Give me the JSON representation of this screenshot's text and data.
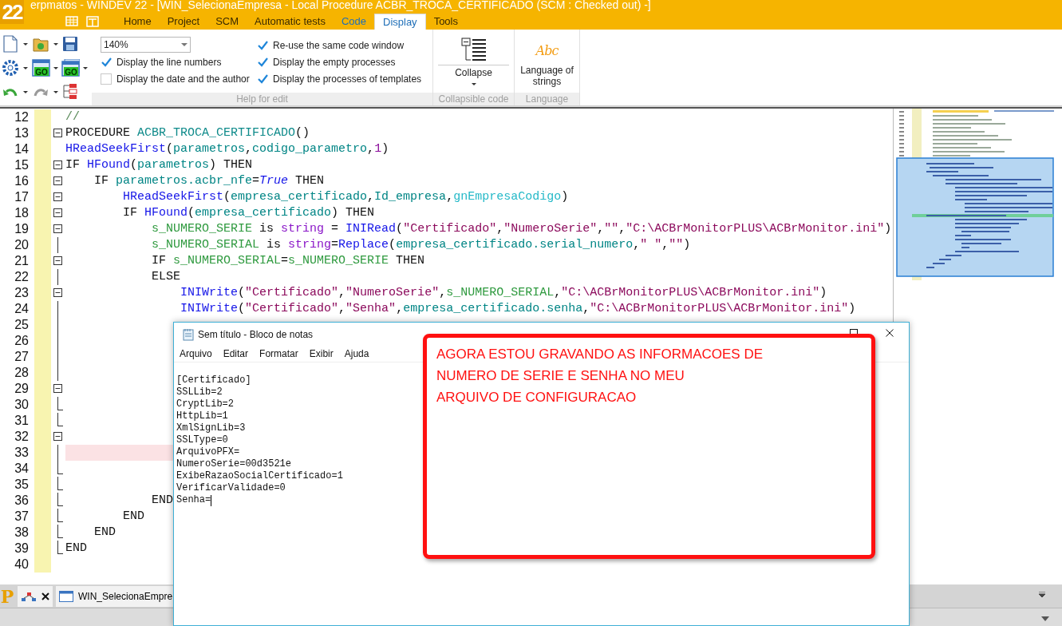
{
  "title_bar": {
    "logo": "22",
    "title": "erpmatos - WINDEV 22 - [WIN_SelecionaEmpresa - Local Procedure ACBR_TROCA_CERTIFICADO (SCM : Checked out) -]"
  },
  "title_tools": [
    {
      "kind": "grid"
    },
    {
      "kind": "form"
    }
  ],
  "ribbon_tabs": [
    {
      "label": "Home",
      "selected": false,
      "contextual": false
    },
    {
      "label": "Project",
      "selected": false,
      "contextual": false
    },
    {
      "label": "SCM",
      "selected": false,
      "contextual": false
    },
    {
      "label": "Automatic tests",
      "selected": false,
      "contextual": false
    },
    {
      "label": "Code",
      "selected": false,
      "contextual": true
    },
    {
      "label": "Display",
      "selected": true,
      "contextual": false
    },
    {
      "label": "Tools",
      "selected": false,
      "contextual": false
    }
  ],
  "quick_tools": [
    {
      "kind": "new",
      "menu": true
    },
    {
      "kind": "open",
      "menu": true
    },
    {
      "kind": "save",
      "menu": false
    },
    {
      "kind": "gear",
      "menu": true
    },
    {
      "kind": "go",
      "text": "GO",
      "menu": true
    },
    {
      "kind": "go2",
      "text": "GO",
      "menu": true
    },
    {
      "kind": "undo",
      "menu": true
    },
    {
      "kind": "redo",
      "menu": true
    },
    {
      "kind": "tree",
      "menu": false
    }
  ],
  "ribbon": {
    "zoom": "140%",
    "options_left": [
      {
        "label": "Display the line numbers",
        "checked": true
      },
      {
        "label": "Display the date and the author",
        "checked": false
      }
    ],
    "options_right": [
      {
        "label": "Re-use the same code window",
        "checked": true
      },
      {
        "label": "Display the empty processes",
        "checked": true
      },
      {
        "label": "Display the processes of templates",
        "checked": true
      }
    ],
    "help_group": "Help for edit",
    "collapse": {
      "label": "Collapse",
      "group": "Collapsible code"
    },
    "language": {
      "icon_text": "Abc",
      "label": "Language of strings",
      "group": "Language"
    }
  },
  "editor": {
    "lines": [
      {
        "number": "12",
        "kind": "plain",
        "highlighted": false,
        "tokens": [
          {
            "kind": "comment",
            "text": "//"
          }
        ]
      },
      {
        "number": "13",
        "kind": "fold",
        "highlighted": false,
        "tokens": [
          {
            "kind": "kw",
            "text": "PROCEDURE "
          },
          {
            "kind": "proc",
            "text": "ACBR_TROCA_CERTIFICADO"
          },
          {
            "kind": "punct",
            "text": "()"
          }
        ]
      },
      {
        "number": "14",
        "kind": "plain",
        "highlighted": false,
        "tokens": [
          {
            "kind": "func",
            "text": "HReadSeekFirst"
          },
          {
            "kind": "punct",
            "text": "("
          },
          {
            "kind": "var",
            "text": "parametros"
          },
          {
            "kind": "punct",
            "text": ","
          },
          {
            "kind": "var",
            "text": "codigo_parametro"
          },
          {
            "kind": "punct",
            "text": ","
          },
          {
            "kind": "num",
            "text": "1"
          },
          {
            "kind": "punct",
            "text": ")"
          }
        ]
      },
      {
        "number": "15",
        "kind": "fold",
        "highlighted": false,
        "tokens": [
          {
            "kind": "kw",
            "text": "IF "
          },
          {
            "kind": "func",
            "text": "HFound"
          },
          {
            "kind": "punct",
            "text": "("
          },
          {
            "kind": "var",
            "text": "parametros"
          },
          {
            "kind": "punct",
            "text": ") "
          },
          {
            "kind": "kw",
            "text": "THEN"
          }
        ]
      },
      {
        "number": "16",
        "kind": "fold",
        "highlighted": false,
        "tokens": [
          {
            "kind": "kw",
            "text": "    IF "
          },
          {
            "kind": "var",
            "text": "parametros.acbr_nfe"
          },
          {
            "kind": "punct",
            "text": "="
          },
          {
            "kind": "bool",
            "text": "True"
          },
          {
            "kind": "kw",
            "text": " THEN"
          }
        ]
      },
      {
        "number": "17",
        "kind": "fold",
        "highlighted": false,
        "tokens": [
          {
            "kind": "func",
            "text": "        HReadSeekFirst"
          },
          {
            "kind": "punct",
            "text": "("
          },
          {
            "kind": "var",
            "text": "empresa_certificado"
          },
          {
            "kind": "punct",
            "text": ","
          },
          {
            "kind": "var",
            "text": "Id_empresa"
          },
          {
            "kind": "punct",
            "text": ","
          },
          {
            "kind": "global",
            "text": "gnEmpresaCodigo"
          },
          {
            "kind": "punct",
            "text": ")"
          }
        ]
      },
      {
        "number": "18",
        "kind": "fold",
        "highlighted": false,
        "tokens": [
          {
            "kind": "kw",
            "text": "        IF "
          },
          {
            "kind": "func",
            "text": "HFound"
          },
          {
            "kind": "punct",
            "text": "("
          },
          {
            "kind": "var",
            "text": "empresa_certificado"
          },
          {
            "kind": "punct",
            "text": ") "
          },
          {
            "kind": "kw",
            "text": "THEN"
          }
        ]
      },
      {
        "number": "19",
        "kind": "fold",
        "highlighted": false,
        "tokens": [
          {
            "kind": "local",
            "text": "            s_NUMERO_SERIE"
          },
          {
            "kind": "kw",
            "text": " is "
          },
          {
            "kind": "type",
            "text": "string"
          },
          {
            "kind": "punct",
            "text": " = "
          },
          {
            "kind": "func",
            "text": "INIRead"
          },
          {
            "kind": "punct",
            "text": "("
          },
          {
            "kind": "str",
            "text": "\"Certificado\""
          },
          {
            "kind": "punct",
            "text": ","
          },
          {
            "kind": "str",
            "text": "\"NumeroSerie\""
          },
          {
            "kind": "punct",
            "text": ","
          },
          {
            "kind": "str",
            "text": "\"\""
          },
          {
            "kind": "punct",
            "text": ","
          },
          {
            "kind": "str",
            "text": "\"C:\\ACBrMonitorPLUS\\ACBrMonitor.ini\""
          },
          {
            "kind": "punct",
            "text": ")"
          }
        ]
      },
      {
        "number": "20",
        "kind": "guide",
        "highlighted": false,
        "tokens": [
          {
            "kind": "local",
            "text": "            s_NUMERO_SERIAL"
          },
          {
            "kind": "kw",
            "text": " is "
          },
          {
            "kind": "type",
            "text": "string"
          },
          {
            "kind": "punct",
            "text": "="
          },
          {
            "kind": "func",
            "text": "Replace"
          },
          {
            "kind": "punct",
            "text": "("
          },
          {
            "kind": "var",
            "text": "empresa_certificado.serial_numero"
          },
          {
            "kind": "punct",
            "text": ","
          },
          {
            "kind": "str",
            "text": "\" \""
          },
          {
            "kind": "punct",
            "text": ","
          },
          {
            "kind": "str",
            "text": "\"\""
          },
          {
            "kind": "punct",
            "text": ")"
          }
        ]
      },
      {
        "number": "21",
        "kind": "fold",
        "highlighted": false,
        "tokens": [
          {
            "kind": "kw",
            "text": "            IF "
          },
          {
            "kind": "local",
            "text": "s_NUMERO_SERIAL"
          },
          {
            "kind": "punct",
            "text": "="
          },
          {
            "kind": "local",
            "text": "s_NUMERO_SERIE"
          },
          {
            "kind": "kw",
            "text": " THEN"
          }
        ]
      },
      {
        "number": "22",
        "kind": "guide",
        "highlighted": false,
        "tokens": [
          {
            "kind": "kw",
            "text": "            ELSE"
          }
        ]
      },
      {
        "number": "23",
        "kind": "fold",
        "highlighted": false,
        "tokens": [
          {
            "kind": "func",
            "text": "                INIWrite"
          },
          {
            "kind": "punct",
            "text": "("
          },
          {
            "kind": "str",
            "text": "\"Certificado\""
          },
          {
            "kind": "punct",
            "text": ","
          },
          {
            "kind": "str",
            "text": "\"NumeroSerie\""
          },
          {
            "kind": "punct",
            "text": ","
          },
          {
            "kind": "local",
            "text": "s_NUMERO_SERIAL"
          },
          {
            "kind": "punct",
            "text": ","
          },
          {
            "kind": "str",
            "text": "\"C:\\ACBrMonitorPLUS\\ACBrMonitor.ini\""
          },
          {
            "kind": "punct",
            "text": ")"
          }
        ]
      },
      {
        "number": "24",
        "kind": "guide",
        "highlighted": false,
        "tokens": [
          {
            "kind": "func",
            "text": "                INIWrite"
          },
          {
            "kind": "punct",
            "text": "("
          },
          {
            "kind": "str",
            "text": "\"Certificado\""
          },
          {
            "kind": "punct",
            "text": ","
          },
          {
            "kind": "str",
            "text": "\"Senha\""
          },
          {
            "kind": "punct",
            "text": ","
          },
          {
            "kind": "var",
            "text": "empresa_certificado.senha"
          },
          {
            "kind": "punct",
            "text": ","
          },
          {
            "kind": "str",
            "text": "\"C:\\ACBrMonitorPLUS\\ACBrMonitor.ini\""
          },
          {
            "kind": "punct",
            "text": ")"
          }
        ]
      },
      {
        "number": "25",
        "kind": "guide",
        "highlighted": false
      },
      {
        "number": "26",
        "kind": "guide",
        "highlighted": false
      },
      {
        "number": "27",
        "kind": "guide",
        "highlighted": false
      },
      {
        "number": "28",
        "kind": "guide",
        "highlighted": false
      },
      {
        "number": "29",
        "kind": "fold",
        "highlighted": false
      },
      {
        "number": "30",
        "kind": "guide_end",
        "highlighted": false
      },
      {
        "number": "31",
        "kind": "guide_end",
        "highlighted": false
      },
      {
        "number": "32",
        "kind": "fold",
        "highlighted": false
      },
      {
        "number": "33",
        "kind": "guide",
        "highlighted": true
      },
      {
        "number": "34",
        "kind": "guide_end",
        "highlighted": false
      },
      {
        "number": "35",
        "kind": "guide_end",
        "highlighted": false
      },
      {
        "number": "36",
        "kind": "guide_end",
        "highlighted": false,
        "tokens": [
          {
            "kind": "kw",
            "text": "            END"
          }
        ]
      },
      {
        "number": "37",
        "kind": "guide_end",
        "highlighted": false,
        "tokens": [
          {
            "kind": "kw",
            "text": "        END"
          }
        ]
      },
      {
        "number": "38",
        "kind": "guide_end",
        "highlighted": false,
        "tokens": [
          {
            "kind": "kw",
            "text": "    END"
          }
        ]
      },
      {
        "number": "39",
        "kind": "guide_end",
        "highlighted": false,
        "tokens": [
          {
            "kind": "kw",
            "text": "END"
          }
        ]
      },
      {
        "number": "40",
        "kind": "plain",
        "highlighted": false
      }
    ]
  },
  "bottom_bar": {
    "logo": "P",
    "tabs": [
      {
        "kind": "diagram",
        "closable": true
      },
      {
        "kind": "window",
        "label": "WIN_SelecionaEmpre",
        "closable": false
      }
    ]
  },
  "notepad": {
    "title": "Sem título - Bloco de notas",
    "menu": [
      "Arquivo",
      "Editar",
      "Formatar",
      "Exibir",
      "Ajuda"
    ],
    "lines": [
      {
        "text": "[Certificado]",
        "caret": false
      },
      {
        "text": "SSLLib=2",
        "caret": false
      },
      {
        "text": "CryptLib=2",
        "caret": false
      },
      {
        "text": "HttpLib=1",
        "caret": false
      },
      {
        "text": "XmlSignLib=3",
        "caret": false
      },
      {
        "text": "SSLType=0",
        "caret": false
      },
      {
        "text": "ArquivoPFX=",
        "caret": false
      },
      {
        "text": "NumeroSerie=00d3521e",
        "caret": false
      },
      {
        "text": "ExibeRazaoSocialCertificado=1",
        "caret": false
      },
      {
        "text": "VerificarValidade=0",
        "caret": false
      },
      {
        "text": "Senha=",
        "caret": true
      }
    ]
  },
  "callout": {
    "lines": [
      "AGORA ESTOU GRAVANDO AS INFORMACOES DE",
      "NUMERO DE SERIE E SENHA NO MEU",
      "ARQUIVO DE CONFIGURACAO"
    ]
  }
}
